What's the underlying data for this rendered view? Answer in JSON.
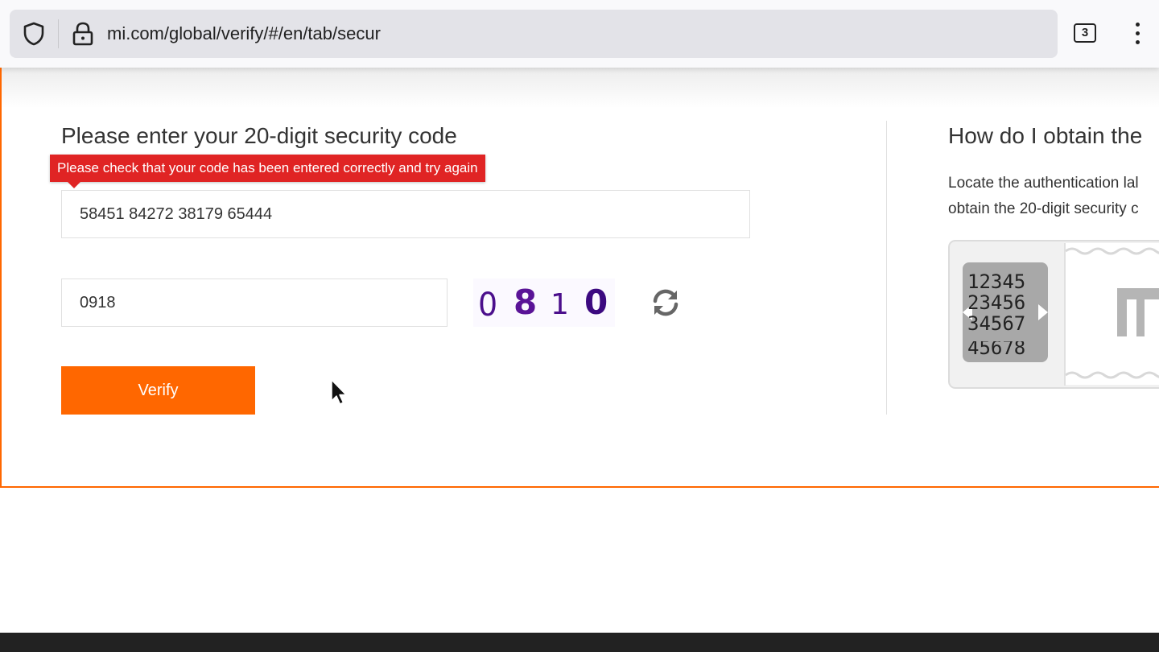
{
  "browser": {
    "url": "mi.com/global/verify/#/en/tab/secur",
    "tab_count": "3"
  },
  "form": {
    "title": "Please enter your 20-digit security code",
    "error_message": "Please check that your code has been entered correctly and try again",
    "security_code_value": "58451 84272 38179 65444",
    "captcha_value": "0918",
    "captcha_image_digits": [
      "0",
      "8",
      "1",
      "0"
    ],
    "verify_label": "Verify"
  },
  "help": {
    "title": "How do I obtain the",
    "text_line1": "Locate the authentication lal",
    "text_line2": "obtain the 20-digit security c",
    "label_rows": [
      "12345",
      "23456",
      "34567",
      "45678"
    ]
  },
  "colors": {
    "accent": "#ff6700",
    "error": "#e02424",
    "captcha_text": "#4b0f8c"
  }
}
